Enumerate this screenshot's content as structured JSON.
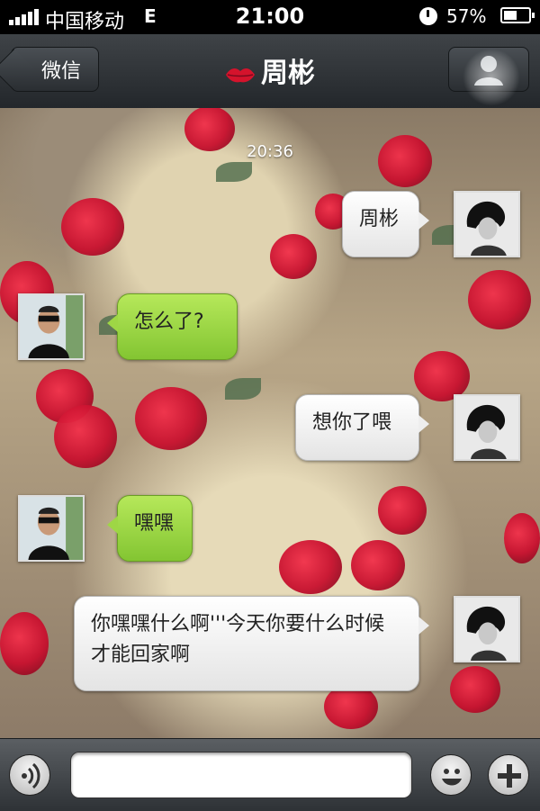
{
  "status_bar": {
    "carrier": "中国移动",
    "network": "E",
    "time": "21:00",
    "battery": "57%"
  },
  "nav": {
    "back_label": "微信",
    "title": "周彬",
    "title_icon": "lips-icon",
    "profile_icon": "person-icon"
  },
  "chat": {
    "timestamp": "20:36",
    "messages": [
      {
        "side": "out",
        "text": "周彬"
      },
      {
        "side": "in",
        "text": "怎么了?"
      },
      {
        "side": "out",
        "text": "想你了喂"
      },
      {
        "side": "in",
        "text": "嘿嘿"
      },
      {
        "side": "out",
        "text": "你嘿嘿什么啊'''今天你要什么时候才能回家啊"
      }
    ]
  },
  "input_bar": {
    "value": "",
    "voice_icon": "voice-icon",
    "emoji_icon": "smiley-icon",
    "plus_icon": "plus-icon"
  },
  "colors": {
    "outgoing_bubble": "#ffffff",
    "incoming_bubble": "#9ed645",
    "lips": "#d4132c"
  }
}
